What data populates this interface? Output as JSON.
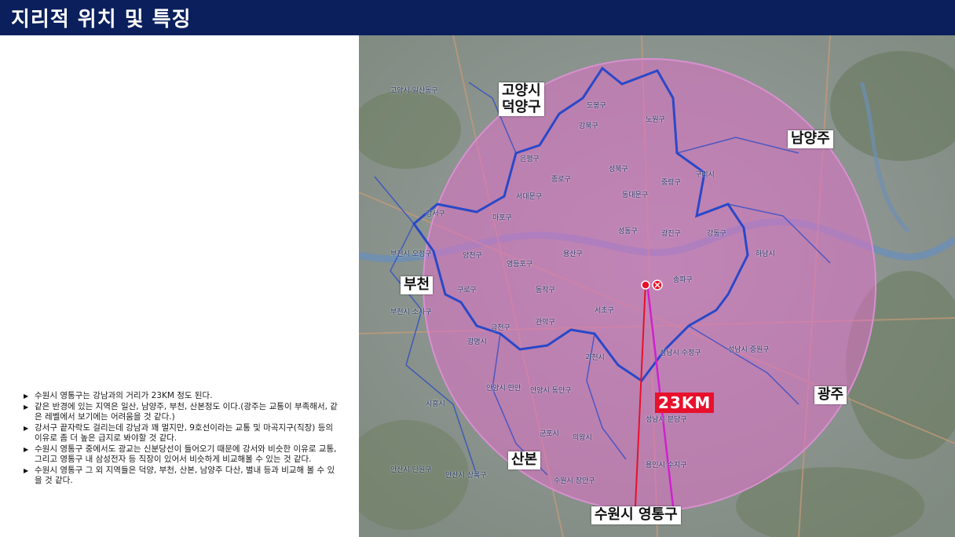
{
  "header": {
    "title": "지리적 위치 및 특징"
  },
  "notes": [
    "수원시 영통구는 강남과의 거리가 23KM 정도 된다.",
    "같은 반경에 있는 지역은 일산, 남양주, 부천, 산본정도 이다.(광주는 교통이 부족해서, 같은 레벨에서 보기에는 어려움을 것 같다.)",
    "강서구 끝자락도 걸리는데 강남과 꽤 멀지만, 9호선이라는 교통 및 마곡지구(직장) 등의 이유로 좀 더 높은 급지로 봐야할 것 같다.",
    "수원시 영통구 중에서도 광교는 신분당선이 들어오기 때문에 강서와 비슷한 이유로 교통, 그리고 영통구 내 삼성전자 등 직장이 있어서 비슷하게 비교해볼 수 있는 것 같다.",
    "수원시 영통구 그 외 지역들은 덕양, 부천, 산본, 남양주 다산, 별내 등과 비교해 볼 수 있을 것 같다."
  ],
  "map": {
    "labels": {
      "goyang": "고양시\n덕양구",
      "namyangju": "남양주",
      "bucheon": "부천",
      "gwangju": "광주",
      "sanbon": "산본",
      "suwon": "수원시 영통구"
    },
    "distance": "23KM",
    "districts": [
      "고양시 일산동구",
      "도봉구",
      "노원구",
      "강북구",
      "은평구",
      "성북구",
      "종로구",
      "중랑구",
      "서대문구",
      "동대문구",
      "구리시",
      "강서구",
      "마포구",
      "성동구",
      "광진구",
      "강동구",
      "부천시 오정구",
      "양천구",
      "영등포구",
      "용산구",
      "송파구",
      "하남시",
      "구로구",
      "동작구",
      "서초구",
      "금천구",
      "관악구",
      "광명시",
      "과천시",
      "성남시 수정구",
      "성남시 중원구",
      "안양시 만안",
      "안양시 동안구",
      "성남시 분당구",
      "시흥시",
      "군포시",
      "의왕시",
      "용인시 수지구",
      "안산시 단원구",
      "안산시 상록구",
      "수원시 장안구",
      "부천시 소사구"
    ],
    "colors": {
      "circle": "#e070c8",
      "route": "#e8102b",
      "border": "#2a48c8"
    }
  }
}
